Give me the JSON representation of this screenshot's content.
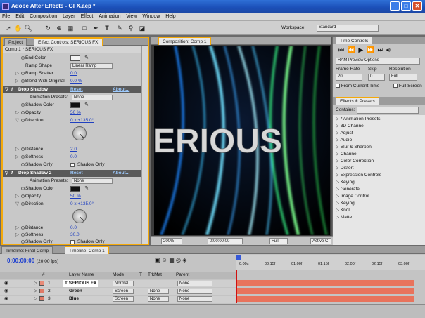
{
  "window": {
    "title": "Adobe After Effects - GFX.aep *"
  },
  "menu": [
    "File",
    "Edit",
    "Composition",
    "Layer",
    "Effect",
    "Animation",
    "View",
    "Window",
    "Help"
  ],
  "workspace": {
    "label": "Workspace:",
    "value": "Standard"
  },
  "left_tabs": {
    "project": "Project",
    "effect_controls": "Effect Controls: SERIOUS FX"
  },
  "effect_controls": {
    "breadcrumb": "Comp 1 * SERIOUS FX",
    "ramp": {
      "end_color": "End Color",
      "ramp_shape": "Ramp Shape",
      "ramp_shape_value": "Linear Ramp",
      "ramp_scatter": "Ramp Scatter",
      "ramp_scatter_value": "0.0",
      "blend": "Blend With Original",
      "blend_value": "0.0 %"
    },
    "shadow1": {
      "name": "Drop Shadow",
      "reset": "Reset",
      "about": "About...",
      "presets": "Animation Presets:",
      "presets_value": "None",
      "shadow_color": "Shadow Color",
      "opacity": "Opacity",
      "opacity_value": "50 %",
      "direction": "Direction",
      "direction_value": "0 x +135.0°",
      "distance": "Distance",
      "distance_value": "2.0",
      "softness": "Softness",
      "softness_value": "0.0",
      "shadow_only": "Shadow Only",
      "shadow_only_check": "Shadow Only"
    },
    "shadow2": {
      "name": "Drop Shadow 2",
      "reset": "Reset",
      "about": "About...",
      "presets": "Animation Presets:",
      "presets_value": "None",
      "shadow_color": "Shadow Color",
      "opacity": "Opacity",
      "opacity_value": "50 %",
      "direction": "Direction",
      "direction_value": "0 x +135.0°",
      "distance": "Distance",
      "distance_value": "0.0",
      "softness": "Softness",
      "softness_value": "30.0",
      "shadow_only": "Shadow Only",
      "shadow_only_check": "Shadow Only"
    }
  },
  "composition": {
    "tab": "Composition: Comp 1",
    "text": "ERIOUS",
    "zoom": "200%",
    "timecode": "0:00:00:00",
    "resolution": "Full",
    "camera": "Active C"
  },
  "time_controls": {
    "tab": "Time Controls",
    "ram_preview": "RAM Preview Options",
    "frame_rate_label": "Frame Rate",
    "frame_rate": "20",
    "skip_label": "Skip",
    "skip": "0",
    "resolution_label": "Resolution",
    "resolution": "Full",
    "from_current": "From Current Time",
    "full_screen": "Full Screen"
  },
  "effects_presets": {
    "tab": "Effects & Presets",
    "contains": "Contains:",
    "items": [
      "* Animation Presets",
      "3D Channel",
      "Adjust",
      "Audio",
      "Blur & Sharpen",
      "Channel",
      "Color Correction",
      "Distort",
      "Expression Controls",
      "Keying",
      "Generate",
      "Image Control",
      "Keying",
      "Knoll",
      "Matte"
    ]
  },
  "timeline": {
    "tabs": [
      "Timeline: Final Comp",
      "Timeline: Comp 1"
    ],
    "timecode": "0:00:00:00",
    "fps": "(20.00 fps)",
    "headers": {
      "num": "#",
      "layer": "Layer Name",
      "mode": "Mode",
      "t": "T",
      "trkmat": "TrkMat",
      "parent": "Parent"
    },
    "ruler": [
      "0:00s",
      "00:15f",
      "01:00f",
      "01:15f",
      "02:00f",
      "02:15f",
      "03:00f"
    ],
    "layers": [
      {
        "num": "1",
        "name": "SERIOUS FX",
        "mode": "Normal",
        "trkmat": "",
        "parent": "None",
        "color": "#e88b78"
      },
      {
        "num": "2",
        "name": "Green",
        "mode": "Screen",
        "trkmat": "None",
        "parent": "None",
        "color": "#e07a66"
      },
      {
        "num": "3",
        "name": "Blue",
        "mode": "Screen",
        "trkmat": "None",
        "parent": "None",
        "color": "#e07a66"
      }
    ]
  },
  "colors": {
    "accent_orange": "#f4a90a",
    "xp_blue": "#1b4fb8",
    "layer_bar": "#e8735c"
  }
}
